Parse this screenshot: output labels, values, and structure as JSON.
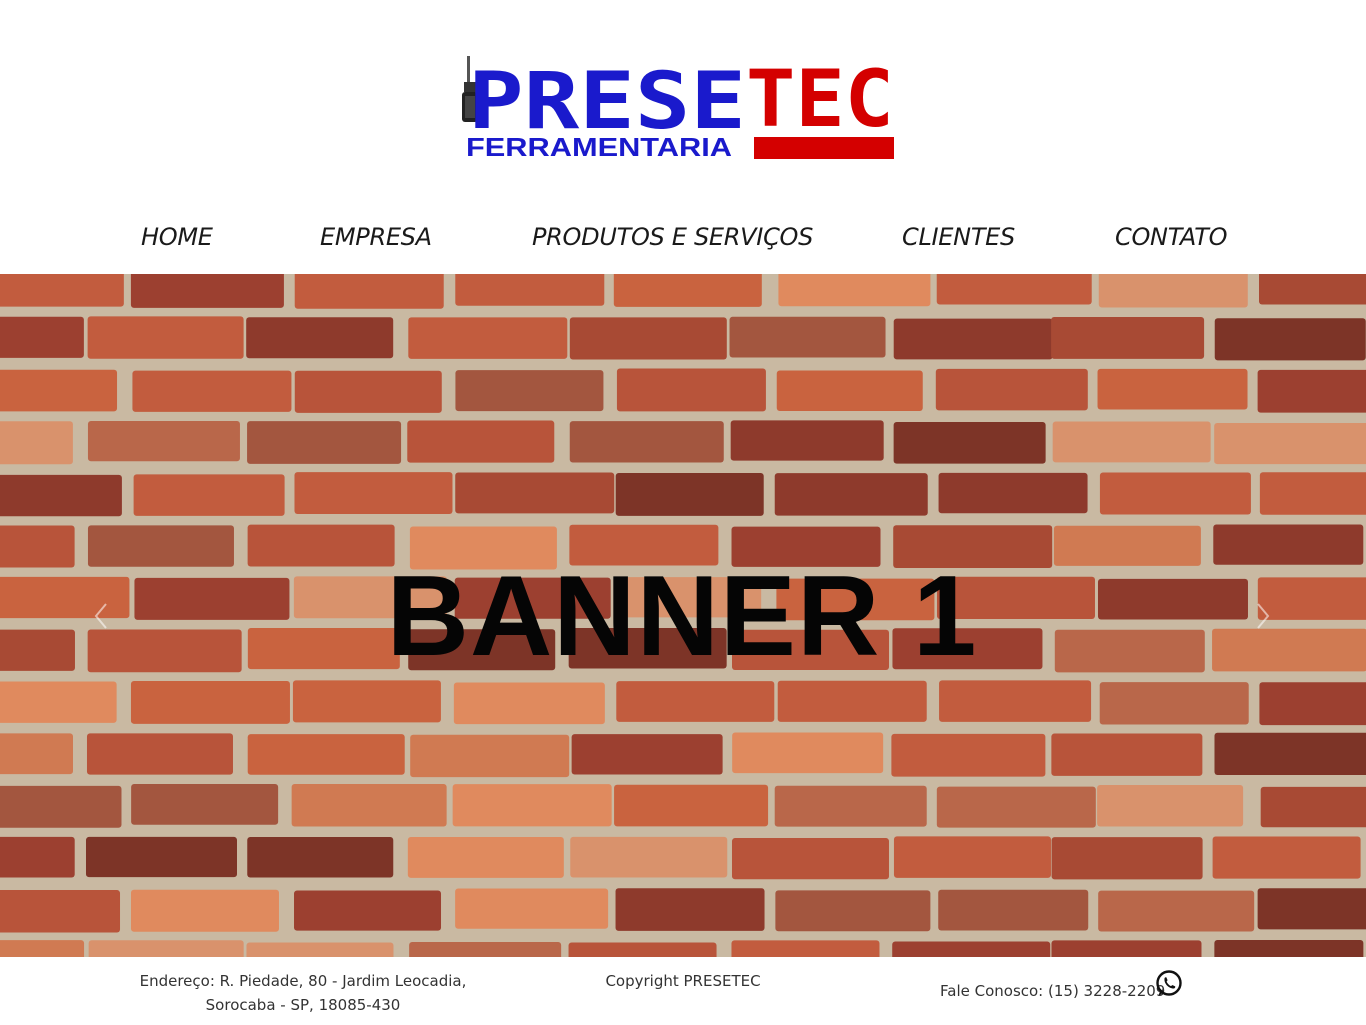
{
  "brand": {
    "name_part1": "PRESE",
    "name_part2": "TEC",
    "subtitle": "FERRAMENTARIA",
    "color_blue": "#1a1acc",
    "color_red": "#d40000"
  },
  "nav": {
    "items": [
      "HOME",
      "EMPRESA",
      "PRODUTOS E SERVIÇOS",
      "CLIENTES",
      "CONTATO"
    ]
  },
  "banner": {
    "title": "BANNER 1",
    "prev_icon": "chevron-left-icon",
    "next_icon": "chevron-right-icon"
  },
  "footer": {
    "address_line1": "Endereço: R. Piedade, 80 - Jardim Leocadia,",
    "address_line2": "Sorocaba - SP, 18085-430",
    "copyright": "Copyright PRESETEC",
    "contact": "Fale Conosco: (15) 3228-2209",
    "contact_icon": "whatsapp-icon"
  }
}
